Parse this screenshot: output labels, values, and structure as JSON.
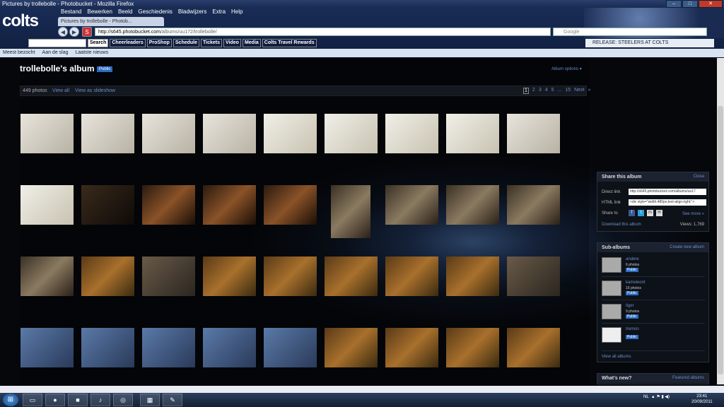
{
  "window": {
    "title": "Pictures by trollebolle - Photobucket - Mozilla Firefox"
  },
  "browser": {
    "logo_text": "colts",
    "menu": [
      "Bestand",
      "Bewerken",
      "Beeld",
      "Geschiedenis",
      "Bladwijzers",
      "Extra",
      "Help"
    ],
    "tab_label": "Pictures by trollebolle - Photob...",
    "url_host": "http://s645.photobucket.com",
    "url_path": "/albums/uu172/trollebolle/",
    "search_placeholder": "Google",
    "toolbar_buttons": [
      "Search",
      "Cheerleaders",
      "ProShop",
      "Schedule",
      "Tickets",
      "Video",
      "Media",
      "Colts Travel Rewards"
    ],
    "release_text": "RELEASE: STEELERS AT COLTS",
    "bookmarks": [
      "Meest bezocht",
      "Aan de slag",
      "Laatste nieuws"
    ]
  },
  "album": {
    "title": "trollebolle's album",
    "badge": "Public",
    "options": "Album options ▾",
    "count": "449 photos",
    "view_all": "View all",
    "view_slideshow": "View as slideshow",
    "pager": [
      "1",
      "2",
      "3",
      "4",
      "5",
      "...",
      "15",
      "Next",
      "»"
    ]
  },
  "thumbnails": [
    [
      "snake",
      "snake",
      "snake",
      "snake",
      "white",
      "white",
      "white",
      "white",
      "snake"
    ],
    [
      "white",
      "dark",
      "orange",
      "orange",
      "orange",
      "room",
      "room",
      "room",
      "room"
    ],
    [
      "room",
      "terr",
      "cat",
      "terr",
      "terr",
      "terr",
      "terr",
      "terr",
      "cat"
    ],
    [
      "bed",
      "bed",
      "bed",
      "bed",
      "bed",
      "terr",
      "terr",
      "terr",
      "terr"
    ]
  ],
  "share": {
    "title": "Share this album",
    "close": "Close",
    "direct_label": "Direct link",
    "direct_value": "http://s645.photobucket.com/albums/uu17",
    "html_label": "HTML link",
    "html_value": "<div style=\"width:480px;text-align:right;\">",
    "share_label": "Share to",
    "see_more": "See more »",
    "download": "Download this album",
    "views": "Views: 1,769"
  },
  "subalbums": {
    "title": "Sub-albums",
    "create": "Create new album",
    "items": [
      {
        "name": "andere",
        "count": "6 photos",
        "badge": "Public"
      },
      {
        "name": "kameleont",
        "count": "15 photos",
        "badge": "Public"
      },
      {
        "name": "tiger",
        "count": "9 photos",
        "badge": "Public"
      },
      {
        "name": "tremon",
        "count": "",
        "badge": "Public"
      }
    ],
    "view_all": "View all albums"
  },
  "whatsnew": {
    "title": "What's new?",
    "link": "Featured albums"
  },
  "taskbar": {
    "lang": "NL",
    "time": "23:41",
    "date": "20/09/2011"
  }
}
